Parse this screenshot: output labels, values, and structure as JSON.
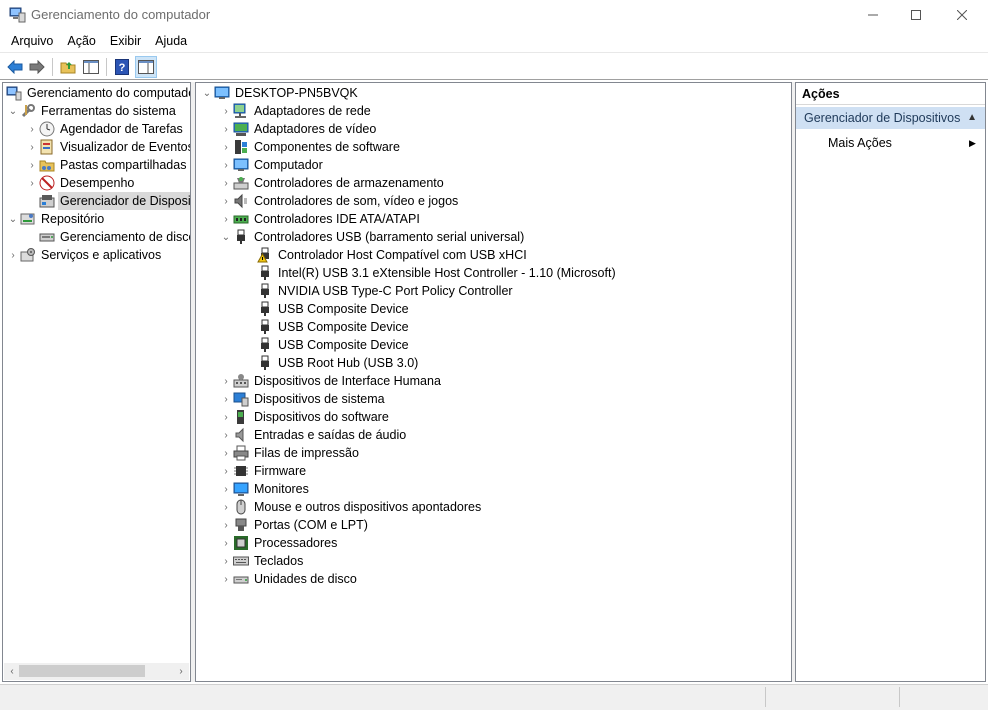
{
  "window": {
    "title": "Gerenciamento do computador"
  },
  "menu": [
    "Arquivo",
    "Ação",
    "Exibir",
    "Ajuda"
  ],
  "left_tree": {
    "root": "Gerenciamento do computador",
    "system_tools": "Ferramentas do sistema",
    "task_scheduler": "Agendador de Tarefas",
    "event_viewer": "Visualizador de Eventos",
    "shared_folders": "Pastas compartilhadas",
    "performance": "Desempenho",
    "device_manager": "Gerenciador de Dispositivos",
    "storage": "Repositório",
    "disk_management": "Gerenciamento de disco",
    "services": "Serviços e aplicativos"
  },
  "device_tree": {
    "computer": "DESKTOP-PN5BVQK",
    "categories": [
      "Adaptadores de rede",
      "Adaptadores de vídeo",
      "Componentes de software",
      "Computador",
      "Controladores de armazenamento",
      "Controladores de som, vídeo e jogos",
      "Controladores IDE ATA/ATAPI",
      "Controladores USB (barramento serial universal)"
    ],
    "usb_children": [
      "Controlador Host Compatível com USB xHCI",
      "Intel(R) USB 3.1 eXtensible Host Controller - 1.10 (Microsoft)",
      "NVIDIA USB Type-C Port Policy Controller",
      "USB Composite Device",
      "USB Composite Device",
      "USB Composite Device",
      "USB Root Hub (USB 3.0)"
    ],
    "categories_after": [
      "Dispositivos de Interface Humana",
      "Dispositivos de sistema",
      "Dispositivos do software",
      "Entradas e saídas de áudio",
      "Filas de impressão",
      "Firmware",
      "Monitores",
      "Mouse e outros dispositivos apontadores",
      "Portas (COM e LPT)",
      "Processadores",
      "Teclados",
      "Unidades de disco"
    ]
  },
  "actions": {
    "header": "Ações",
    "section": "Gerenciador de Dispositivos",
    "more": "Mais Ações"
  },
  "colors": {
    "selection_gray": "#d9d9d9",
    "actions_section_bg": "#cfe0f3",
    "warning_yellow": "#f2c811"
  }
}
